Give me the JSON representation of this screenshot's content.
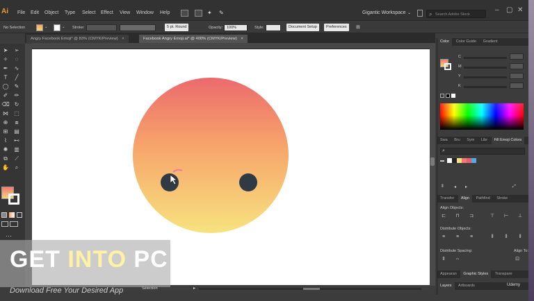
{
  "app": {
    "logo": "Ai",
    "workspace": "Gigantic Workspace",
    "search_placeholder": "Search Adobe Stock"
  },
  "menu": [
    "File",
    "Edit",
    "Object",
    "Type",
    "Select",
    "Effect",
    "View",
    "Window",
    "Help"
  ],
  "control": {
    "selection": "No Selection",
    "stroke_label": "Stroke:",
    "brush": "5 pt. Round",
    "opacity_label": "Opacity:",
    "opacity_value": "100%",
    "style_label": "Style:",
    "doc_setup": "Document Setup",
    "preferences": "Preferences"
  },
  "tabs": [
    {
      "label": "Angry Facebook Emoji* @ 83% (CMYK/Preview)",
      "close": "×"
    },
    {
      "label": "Facebook Angry Emoji.ai* @ 400% (CMYK/Preview)",
      "close": "×"
    }
  ],
  "color_panel": {
    "tabs": [
      "Color",
      "Color Guide",
      "Gradient"
    ],
    "channels": [
      "C",
      "M",
      "Y",
      "K"
    ]
  },
  "swatch_panel": {
    "tabs": [
      "Swa",
      "Bru",
      "Sym",
      "Libr",
      "Fill Emoji Colors"
    ],
    "chips": [
      "#ffffff",
      "#222222",
      "#f6e07c",
      "#f07a78",
      "#e85f6e",
      "#56a8e0"
    ]
  },
  "align_panel": {
    "tabs": [
      "Transfor",
      "Align",
      "Pathfind",
      "Stroke"
    ],
    "align_objects": "Align Objects:",
    "distribute_objects": "Distribute Objects:",
    "distribute_spacing": "Distribute Spacing:",
    "align_to": "Align To:"
  },
  "bottom_tabs": {
    "row1": [
      "Appearan",
      "Graphic Styles",
      "Transpare"
    ],
    "row2": [
      "Layers",
      "Artboards"
    ]
  },
  "status": {
    "mode": "Selection"
  },
  "watermark": {
    "part1": "GET ",
    "part2": "INTO",
    "part3": " PC",
    "subtitle": "Download Free Your Desired App",
    "badge": "Udemy"
  },
  "colors": {
    "face_top": "#ec6a6d",
    "face_mid": "#f7a66b",
    "face_bottom": "#f7e27f",
    "eye": "#2f3a44",
    "brow": "#f07aa0"
  }
}
